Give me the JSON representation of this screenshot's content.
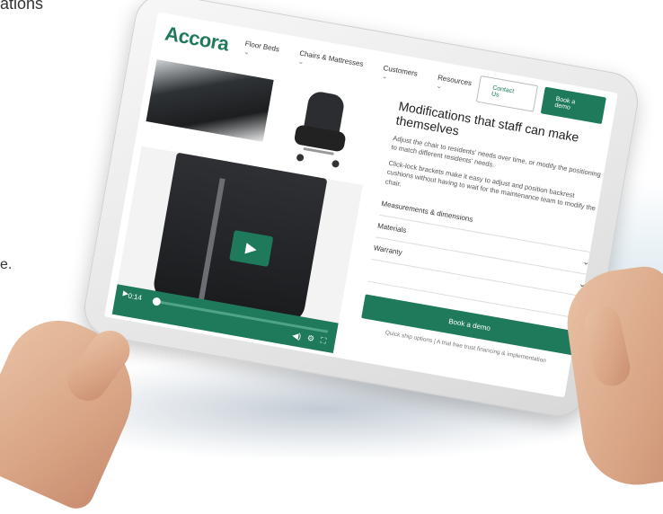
{
  "background": {
    "text_top": "ations",
    "text_mid": "e."
  },
  "nav": {
    "logo": "Accora",
    "menu": [
      "Floor Beds",
      "Chairs & Mattresses",
      "Customers",
      "Resources"
    ],
    "contact_button": "Contact Us",
    "demo_button": "Book a demo"
  },
  "video": {
    "time": "0:14",
    "controls": [
      "◀)",
      "⚙",
      "⛶"
    ]
  },
  "panel": {
    "title": "Modifications that staff can make themselves",
    "para1": "Adjust the chair to residents' needs over time, or modify the positioning to match different residents' needs.",
    "para2": "Click-lock brackets make it easy to adjust and position backrest cushions without having to wait for the maintenance team to modify the chair.",
    "accordion": [
      "Measurements & dimensions",
      "Materials",
      "Warranty",
      ""
    ],
    "demo_button": "Book a demo",
    "note": "Quick ship options | A trial free trust financing & implementation"
  },
  "colors": {
    "brand_green": "#1f7a5c"
  }
}
